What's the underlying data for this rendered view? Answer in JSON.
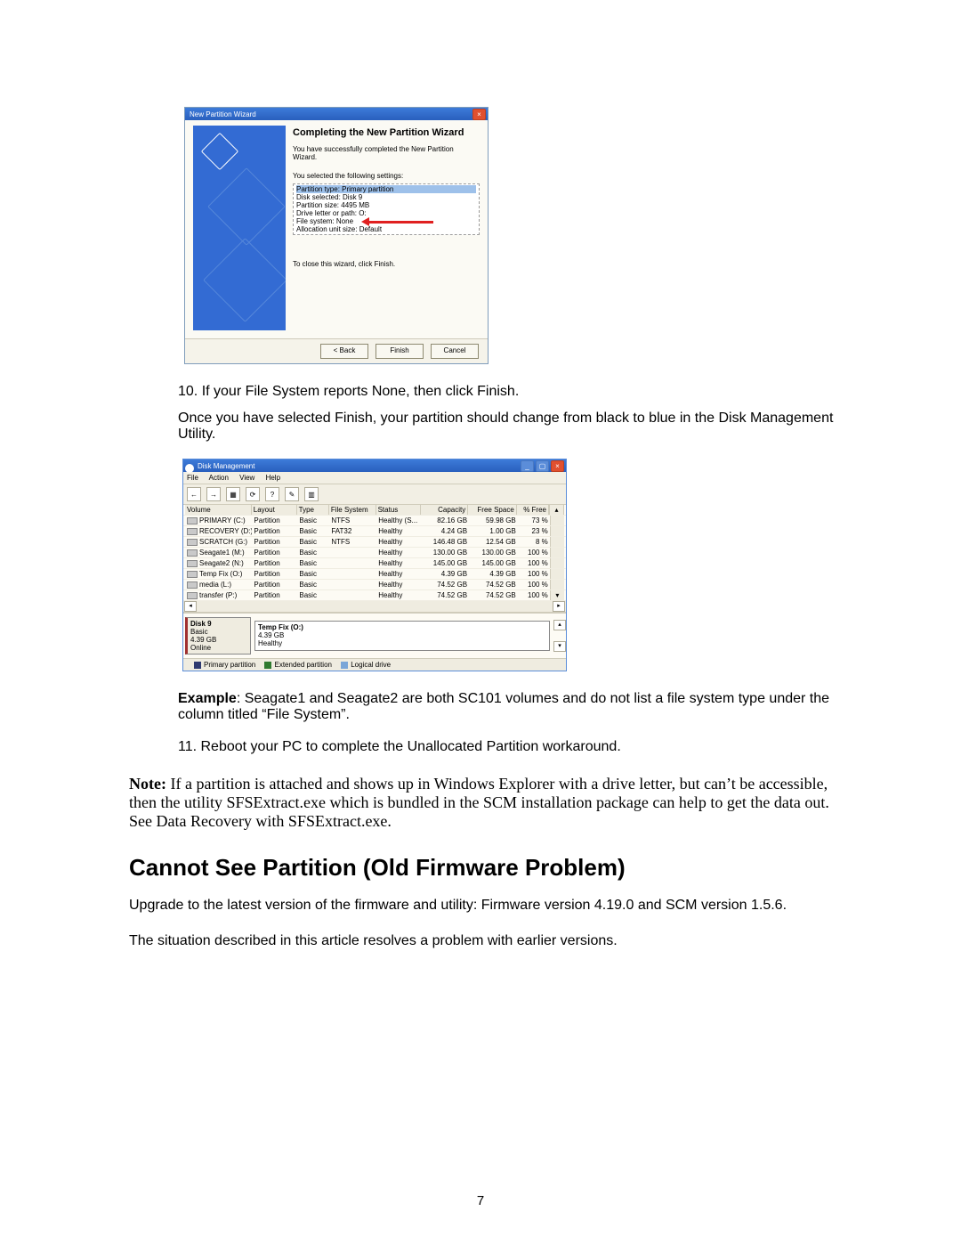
{
  "wizard": {
    "title": "New Partition Wizard",
    "heading": "Completing the New Partition Wizard",
    "success": "You have successfully completed the New Partition Wizard.",
    "selected_label": "You selected the following settings:",
    "settings": [
      "Partition type: Primary partition",
      "Disk selected: Disk 9",
      "Partition size: 4495 MB",
      "Drive letter or path: O:",
      "File system: None",
      "Allocation unit size: Default"
    ],
    "close_label": "To close this wizard, click Finish.",
    "buttons": {
      "back": "< Back",
      "finish": "Finish",
      "cancel": "Cancel"
    }
  },
  "step10": "If your File System reports None, then click Finish.",
  "after_finish": "Once you have selected Finish, your partition should change from black to blue in the Disk Management Utility.",
  "dm": {
    "title": "Disk Management",
    "menu": [
      "File",
      "Action",
      "View",
      "Help"
    ],
    "columns": [
      "Volume",
      "Layout",
      "Type",
      "File System",
      "Status",
      "Capacity",
      "Free Space",
      "% Free"
    ],
    "rows": [
      {
        "vol": "PRIMARY (C:)",
        "lay": "Partition",
        "typ": "Basic",
        "fs": "NTFS",
        "sta": "Healthy (S...",
        "cap": "82.16 GB",
        "fsp": "59.98 GB",
        "pf": "73 %"
      },
      {
        "vol": "RECOVERY (D:)",
        "lay": "Partition",
        "typ": "Basic",
        "fs": "FAT32",
        "sta": "Healthy",
        "cap": "4.24 GB",
        "fsp": "1.00 GB",
        "pf": "23 %"
      },
      {
        "vol": "SCRATCH (G:)",
        "lay": "Partition",
        "typ": "Basic",
        "fs": "NTFS",
        "sta": "Healthy",
        "cap": "146.48 GB",
        "fsp": "12.54 GB",
        "pf": "8 %"
      },
      {
        "vol": "Seagate1 (M:)",
        "lay": "Partition",
        "typ": "Basic",
        "fs": "",
        "sta": "Healthy",
        "cap": "130.00 GB",
        "fsp": "130.00 GB",
        "pf": "100 %"
      },
      {
        "vol": "Seagate2 (N:)",
        "lay": "Partition",
        "typ": "Basic",
        "fs": "",
        "sta": "Healthy",
        "cap": "145.00 GB",
        "fsp": "145.00 GB",
        "pf": "100 %"
      },
      {
        "vol": "Temp Fix (O:)",
        "lay": "Partition",
        "typ": "Basic",
        "fs": "",
        "sta": "Healthy",
        "cap": "4.39 GB",
        "fsp": "4.39 GB",
        "pf": "100 %"
      },
      {
        "vol": "media (L:)",
        "lay": "Partition",
        "typ": "Basic",
        "fs": "",
        "sta": "Healthy",
        "cap": "74.52 GB",
        "fsp": "74.52 GB",
        "pf": "100 %"
      },
      {
        "vol": "transfer (P:)",
        "lay": "Partition",
        "typ": "Basic",
        "fs": "",
        "sta": "Healthy",
        "cap": "74.52 GB",
        "fsp": "74.52 GB",
        "pf": "100 %"
      }
    ],
    "disk_label": "Disk 9",
    "disk_lines": [
      "Basic",
      "4.39 GB",
      "Online"
    ],
    "part_lines": [
      "Temp Fix  (O:)",
      "4.39 GB",
      "Healthy"
    ],
    "legend": [
      "Primary partition",
      "Extended partition",
      "Logical drive"
    ]
  },
  "example_lead": "Example",
  "example_body": ": Seagate1 and Seagate2 are both SC101 volumes and do not list a file system type under the column titled “File System”.",
  "step11": "Reboot your PC to complete the Unallocated Partition workaround.",
  "note_lead": "Note:",
  "note_body": " If a partition is attached and shows up in Windows Explorer with a drive letter, but can’t be accessible, then the utility SFSExtract.exe which is bundled in the SCM installation package can help to get the data out. See Data Recovery with SFSExtract.exe.",
  "section_heading": "Cannot See Partition (Old Firmware Problem)",
  "firmware_para": "Upgrade to the latest version of the firmware and utility: Firmware version 4.19.0 and SCM version 1.5.6.",
  "situation_para": "The situation described in this article resolves a problem with earlier versions.",
  "page_number": "7"
}
